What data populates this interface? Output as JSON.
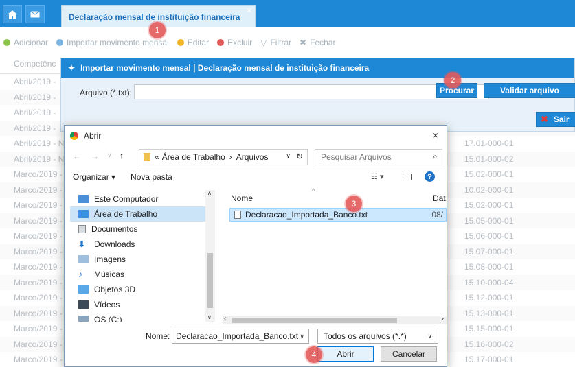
{
  "tabs": {
    "main": "Declaração mensal de instituição financeira",
    "close": "×"
  },
  "toolbar": [
    {
      "label": "Adicionar",
      "color": "#8cc34a"
    },
    {
      "label": "Importar movimento mensal",
      "color": "#7ab3e0"
    },
    {
      "label": "Editar",
      "color": "#f0b429"
    },
    {
      "label": "Excluir",
      "color": "#e05b5b"
    },
    {
      "label": "Filtrar",
      "color": "#b0b6bb"
    },
    {
      "label": "Fechar",
      "color": "#b0b6bb"
    }
  ],
  "grid": {
    "header": "Competênc",
    "rows": [
      {
        "c1": "Abril/2019 -",
        "c2": ""
      },
      {
        "c1": "Abril/2019 -",
        "c2": ""
      },
      {
        "c1": "Abril/2019 -",
        "c2": ""
      },
      {
        "c1": "Abril/2019 -",
        "c2": ""
      },
      {
        "c1": "Abril/2019 - N",
        "c2": "17.01-000-01"
      },
      {
        "c1": "Abril/2019 - N",
        "c2": "15.01-000-02"
      },
      {
        "c1": "Marco/2019 -",
        "c2": "15.02-000-01"
      },
      {
        "c1": "Marco/2019 -",
        "c2": "10.02-000-01"
      },
      {
        "c1": "Marco/2019 -",
        "c2": "15.02-000-01"
      },
      {
        "c1": "Marco/2019 -",
        "c2": "15.05-000-01"
      },
      {
        "c1": "Marco/2019 -",
        "c2": "15.06-000-01"
      },
      {
        "c1": "Marco/2019 -",
        "c2": "15.07-000-01"
      },
      {
        "c1": "Marco/2019 -",
        "c2": "15.08-000-01"
      },
      {
        "c1": "Marco/2019 -",
        "c2": "15.10-000-04"
      },
      {
        "c1": "Marco/2019 -",
        "c2": "15.12-000-01"
      },
      {
        "c1": "Marco/2019 -",
        "c2": "15.13-000-01"
      },
      {
        "c1": "Marco/2019 -",
        "c2": "15.15-000-01"
      },
      {
        "c1": "Marco/2019 -",
        "c2": "15.16-000-02"
      },
      {
        "c1": "Marco/2019 -",
        "c2": "15.17-000-01"
      }
    ]
  },
  "modal": {
    "title": "Importar movimento mensal | Declaração mensal de instituição financeira",
    "file_label": "Arquivo (*.txt):",
    "file_value": "",
    "browse": "Procurar",
    "validate": "Validar arquivo",
    "exit": "Sair"
  },
  "dialog": {
    "title": "Abrir",
    "close": "×",
    "path_root": "«",
    "path_a": "Área de Trabalho",
    "path_sep": "›",
    "path_b": "Arquivos",
    "search_placeholder": "Pesquisar Arquivos",
    "organize": "Organizar ▾",
    "new_folder": "Nova pasta",
    "nav": [
      {
        "label": "Este Computador",
        "icon": "computer-icon"
      },
      {
        "label": "Área de Trabalho",
        "icon": "desktop-icon",
        "selected": true
      },
      {
        "label": "Documentos",
        "icon": "documents-icon"
      },
      {
        "label": "Downloads",
        "icon": "downloads-icon"
      },
      {
        "label": "Imagens",
        "icon": "images-icon"
      },
      {
        "label": "Músicas",
        "icon": "music-icon"
      },
      {
        "label": "Objetos 3D",
        "icon": "objects3d-icon"
      },
      {
        "label": "Vídeos",
        "icon": "videos-icon"
      },
      {
        "label": "OS (C:)",
        "icon": "drive-icon"
      }
    ],
    "col_name": "Nome",
    "col_date": "Dat",
    "file_name": "Declaracao_Importada_Banco.txt",
    "file_date": "08/",
    "name_label": "Nome:",
    "name_value": "Declaracao_Importada_Banco.txt",
    "type_value": "Todos os arquivos (*.*)",
    "open": "Abrir",
    "cancel": "Cancelar"
  },
  "badges": [
    "1",
    "2",
    "3",
    "4"
  ]
}
